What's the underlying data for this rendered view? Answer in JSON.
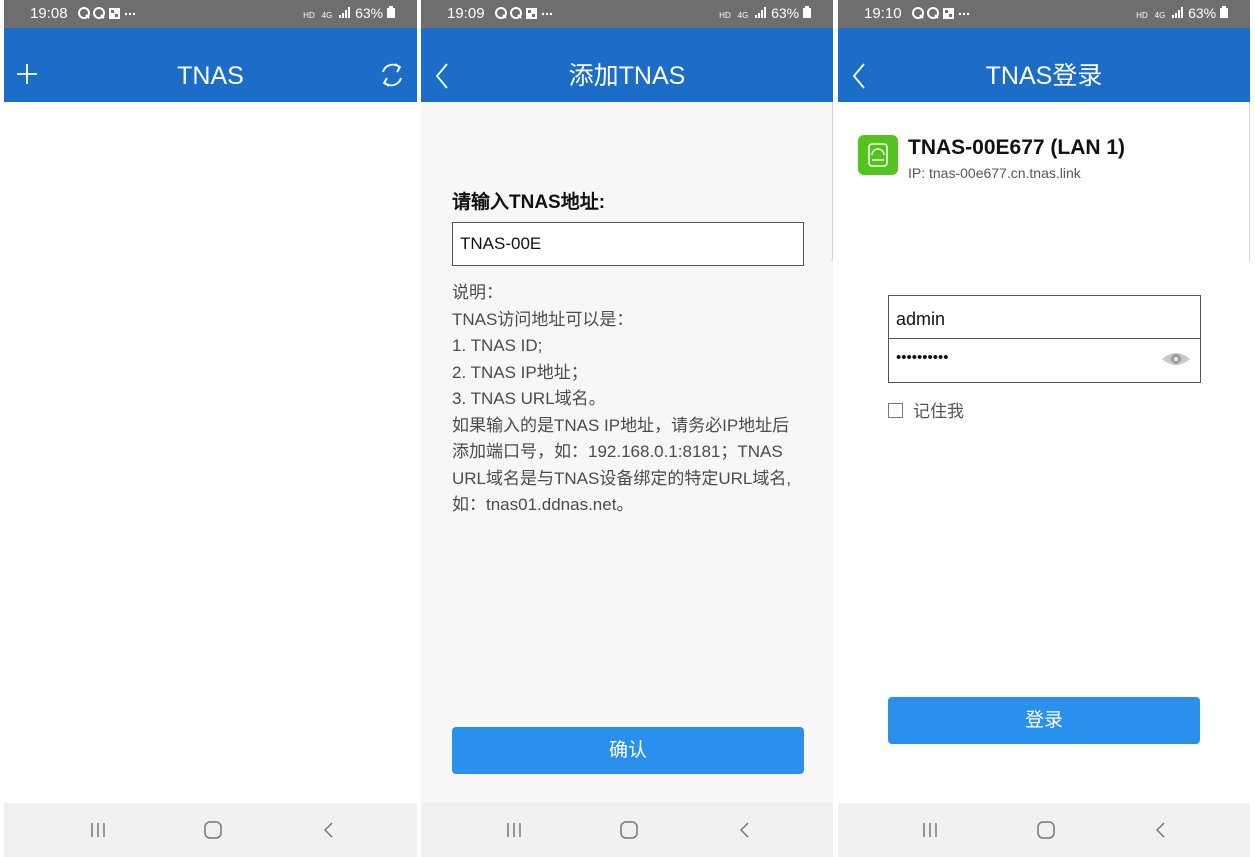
{
  "statusbar": {
    "times": [
      "19:08",
      "19:09",
      "19:10"
    ],
    "notif_icons": "Q Q ▦ ···",
    "hd": "HD",
    "net": "4G",
    "battery": "63%"
  },
  "screen1": {
    "title": "TNAS"
  },
  "screen2": {
    "title": "添加TNAS",
    "prompt": "请输入TNAS地址:",
    "input_value": "TNAS-00E",
    "desc_lines": [
      "说明：",
      "TNAS访问地址可以是：",
      "1. TNAS ID;",
      "2. TNAS IP地址；",
      "3. TNAS URL域名。",
      "如果输入的是TNAS IP地址，请务必IP地址后",
      "添加端口号，如：192.168.0.1:8181；TNAS",
      "URL域名是与TNAS设备绑定的特定URL域名,",
      "如：tnas01.ddnas.net。"
    ],
    "confirm_label": "确认"
  },
  "screen3": {
    "title": "TNAS登录",
    "device_name": "TNAS-00E677 (LAN 1)",
    "device_ip": "IP: tnas-00e677.cn.tnas.link",
    "username": "admin",
    "password_mask": "••••••••••",
    "remember_label": "记住我",
    "login_label": "登录"
  },
  "colors": {
    "header": "#1c6dc8",
    "button": "#2a90ee",
    "device_icon": "#53c41c",
    "statusbar": "#6e6e6e",
    "navbar": "#f1f1f1"
  },
  "icons": [
    "add-icon",
    "refresh-icon",
    "back-icon",
    "recent-apps-icon",
    "home-icon",
    "nav-back-icon",
    "nas-device-icon",
    "eye-icon"
  ]
}
